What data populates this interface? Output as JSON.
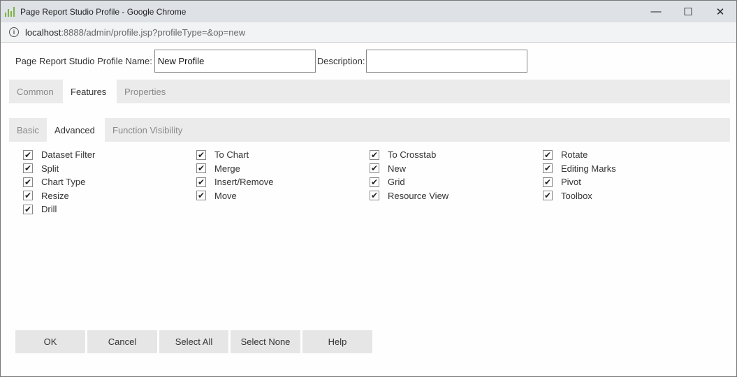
{
  "window": {
    "title": "Page Report Studio Profile - Google Chrome",
    "url_host": "localhost",
    "url_rest": ":8888/admin/profile.jsp?profileType=&op=new"
  },
  "form": {
    "name_label": "Page Report Studio Profile Name:",
    "name_value": "New Profile",
    "description_label": "Description:",
    "description_value": ""
  },
  "tabs": [
    {
      "label": "Common"
    },
    {
      "label": "Features",
      "active": true
    },
    {
      "label": "Properties"
    }
  ],
  "subtabs": [
    {
      "label": "Basic"
    },
    {
      "label": "Advanced",
      "active": true
    },
    {
      "label": "Function Visibility"
    }
  ],
  "columns": [
    [
      {
        "label": "Dataset Filter",
        "checked": true
      },
      {
        "label": "Split",
        "checked": true
      },
      {
        "label": "Chart Type",
        "checked": true
      },
      {
        "label": "Resize",
        "checked": true
      },
      {
        "label": "Drill",
        "checked": true
      }
    ],
    [
      {
        "label": "To Chart",
        "checked": true
      },
      {
        "label": "Merge",
        "checked": true
      },
      {
        "label": "Insert/Remove",
        "checked": true
      },
      {
        "label": "Move",
        "checked": true
      }
    ],
    [
      {
        "label": "To Crosstab",
        "checked": true
      },
      {
        "label": "New",
        "checked": true
      },
      {
        "label": "Grid",
        "checked": true
      },
      {
        "label": "Resource View",
        "checked": true
      }
    ],
    [
      {
        "label": "Rotate",
        "checked": true
      },
      {
        "label": "Editing Marks",
        "checked": true
      },
      {
        "label": "Pivot",
        "checked": true
      },
      {
        "label": "Toolbox",
        "checked": true
      }
    ]
  ],
  "buttons": [
    "OK",
    "Cancel",
    "Select All",
    "Select None",
    "Help"
  ]
}
